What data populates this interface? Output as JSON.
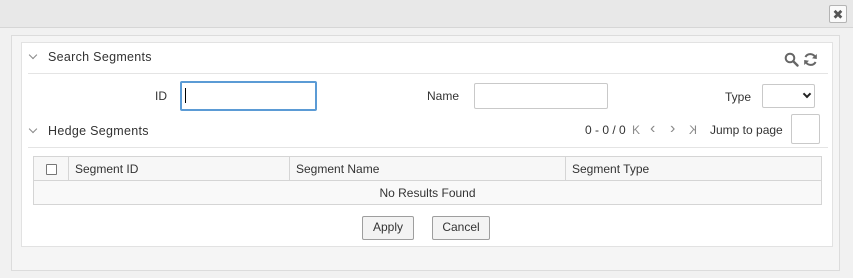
{
  "dialog": {
    "close_symbol": "✖"
  },
  "search_section": {
    "title": "Search Segments",
    "id_label": "ID",
    "id_value": "",
    "name_label": "Name",
    "name_value": "",
    "type_label": "Type",
    "type_selected": "",
    "icons": [
      "search-icon",
      "refresh-icon"
    ]
  },
  "hedge_section": {
    "title": "Hedge Segments",
    "pager": {
      "range": "0 - 0 / 0",
      "first": "K",
      "prev": "‹",
      "next": "›",
      "last": "K",
      "jump_label": "Jump to page",
      "jump_value": ""
    },
    "table": {
      "columns": [
        "Segment ID",
        "Segment Name",
        "Segment Type"
      ],
      "empty_message": "No Results Found"
    }
  },
  "buttons": {
    "apply": "Apply",
    "cancel": "Cancel"
  },
  "colors": {
    "focus_border": "#5b9bd5",
    "panel_bg": "#f5f5f5"
  }
}
